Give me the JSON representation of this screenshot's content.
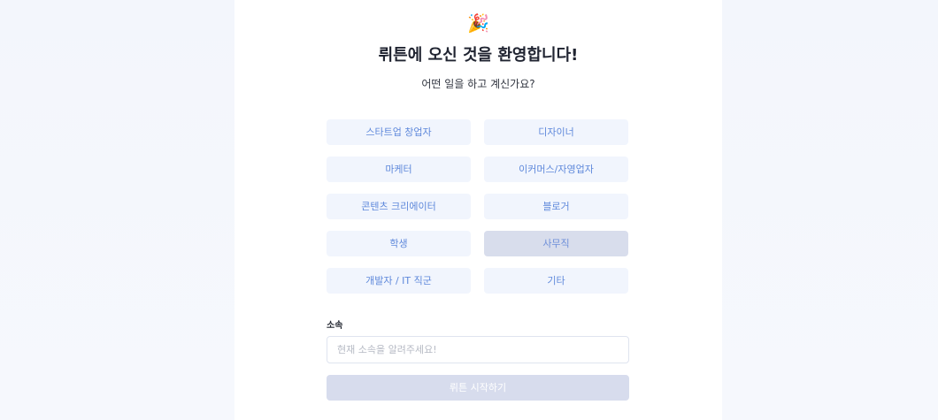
{
  "header": {
    "emoji_icon": "🎉",
    "title": "뤼튼에 오신 것을 환영합니다!",
    "subtitle": "어떤 일을 하고 계신가요?"
  },
  "roles": [
    {
      "label": "스타트업 창업자",
      "selected": false
    },
    {
      "label": "디자이너",
      "selected": false
    },
    {
      "label": "마케터",
      "selected": false
    },
    {
      "label": "이커머스/자영업자",
      "selected": false
    },
    {
      "label": "콘텐츠 크리에이터",
      "selected": false
    },
    {
      "label": "블로거",
      "selected": false
    },
    {
      "label": "학생",
      "selected": false
    },
    {
      "label": "사무직",
      "selected": true
    },
    {
      "label": "개발자 / IT 직군",
      "selected": false
    },
    {
      "label": "기타",
      "selected": false
    }
  ],
  "affiliation": {
    "label": "소속",
    "placeholder": "현재 소속을 알려주세요!",
    "value": ""
  },
  "start_button": {
    "label": "뤼튼 시작하기"
  },
  "colors": {
    "background": "#f5f7fc",
    "card": "#ffffff",
    "role_bg": "#f1f5fd",
    "role_text": "#5f89db",
    "selected_bg": "#d8ddec",
    "disabled_button": "#d7dced"
  }
}
